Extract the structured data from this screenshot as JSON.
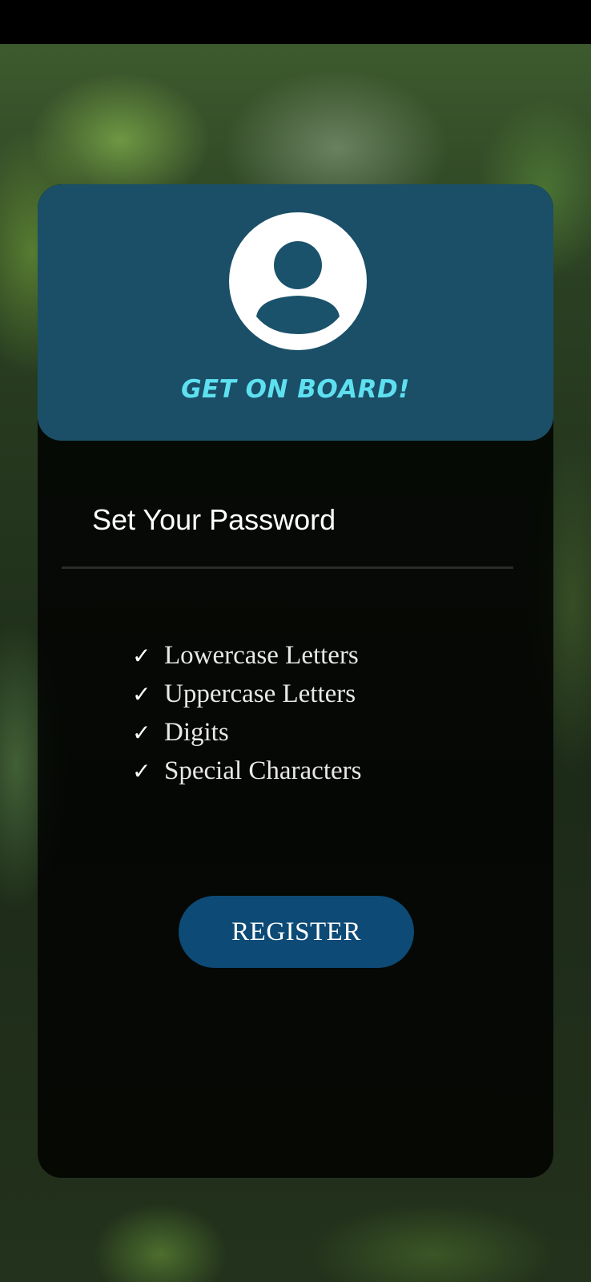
{
  "header": {
    "avatar_icon": "user-avatar-icon",
    "title": "GET ON BOARD!"
  },
  "form": {
    "section_title": "Set Your Password",
    "requirements": [
      {
        "check": "✓",
        "label": "Lowercase Letters"
      },
      {
        "check": "✓",
        "label": "Uppercase Letters"
      },
      {
        "check": "✓",
        "label": "Digits"
      },
      {
        "check": "✓",
        "label": "Special Characters"
      }
    ],
    "register_label": "REGISTER"
  },
  "colors": {
    "header_bg": "#1b526b",
    "title_accent": "#5ee0f0",
    "button_bg": "#0d4a76",
    "card_bg": "#000000"
  }
}
